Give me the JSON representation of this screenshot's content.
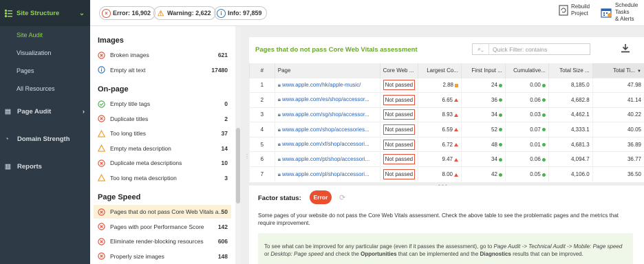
{
  "nav": {
    "header": "Site Structure",
    "sub_items": [
      "Site Audit",
      "Visualization",
      "Pages",
      "All Resources"
    ],
    "sections": [
      {
        "label": "Page Audit",
        "icon": "document-icon"
      },
      {
        "label": "Domain Strength",
        "icon": "gauge-icon"
      },
      {
        "label": "Reports",
        "icon": "report-icon"
      }
    ]
  },
  "topbar": {
    "error": "Error: 16,902",
    "warning": "Warning: 2,622",
    "info": "Info: 97,859",
    "rebuild": [
      "Rebuild",
      "Project"
    ],
    "schedule": [
      "Schedule",
      "Tasks",
      "& Alerts"
    ]
  },
  "issues": {
    "images_title": "Images",
    "images": [
      {
        "label": "Broken images",
        "count": "621",
        "type": "error"
      },
      {
        "label": "Empty alt text",
        "count": "17480",
        "type": "info"
      }
    ],
    "onpage_title": "On-page",
    "onpage": [
      {
        "label": "Empty title tags",
        "count": "0",
        "type": "ok"
      },
      {
        "label": "Duplicate titles",
        "count": "2",
        "type": "error"
      },
      {
        "label": "Too long titles",
        "count": "37",
        "type": "warning"
      },
      {
        "label": "Empty meta description",
        "count": "14",
        "type": "warning"
      },
      {
        "label": "Duplicate meta descriptions",
        "count": "10",
        "type": "error"
      },
      {
        "label": "Too long meta description",
        "count": "3",
        "type": "warning"
      }
    ],
    "speed_title": "Page Speed",
    "speed": [
      {
        "label": "Pages that do not pass Core Web Vitals a...",
        "count": "50",
        "type": "error"
      },
      {
        "label": "Pages with poor Performance Score",
        "count": "142",
        "type": "error"
      },
      {
        "label": "Eliminate render-blocking resources",
        "count": "606",
        "type": "error"
      },
      {
        "label": "Properly size images",
        "count": "148",
        "type": "error"
      }
    ]
  },
  "table": {
    "title": "Pages that do not pass Core Web Vitals assessment",
    "filter_placeholder": "Quick Filter: contains",
    "columns": [
      "#",
      "Page",
      "Core Web ...",
      "Largest Co...",
      "First Input ...",
      "Cumulative...",
      "Total Size ...",
      "Total Ti..."
    ],
    "rows": [
      {
        "n": "1",
        "page": "www.apple.com/hk/apple-music/",
        "cwv": "Not passed",
        "lcp": "2.88",
        "lcp_m": "sq",
        "fid": "24",
        "fid_m": "dot",
        "cls": "0.00",
        "cls_m": "dot",
        "size": "8,185.0",
        "time": "47.98"
      },
      {
        "n": "2",
        "page": "www.apple.com/es/shop/accessor...",
        "cwv": "Not passed",
        "lcp": "6.65",
        "lcp_m": "tri",
        "fid": "36",
        "fid_m": "dot",
        "cls": "0.06",
        "cls_m": "dot",
        "size": "4,682.8",
        "time": "41.14"
      },
      {
        "n": "3",
        "page": "www.apple.com/sg/shop/accessor...",
        "cwv": "Not passed",
        "lcp": "8.93",
        "lcp_m": "tri",
        "fid": "34",
        "fid_m": "dot",
        "cls": "0.03",
        "cls_m": "dot",
        "size": "4,462.1",
        "time": "40.22"
      },
      {
        "n": "4",
        "page": "www.apple.com/shop/accessories...",
        "cwv": "Not passed",
        "lcp": "6.59",
        "lcp_m": "tri",
        "fid": "52",
        "fid_m": "dot",
        "cls": "0.07",
        "cls_m": "dot",
        "size": "4,333.1",
        "time": "40.05"
      },
      {
        "n": "5",
        "page": "www.apple.com/xf/shop/accessori...",
        "cwv": "Not passed",
        "lcp": "6.72",
        "lcp_m": "tri",
        "fid": "48",
        "fid_m": "dot",
        "cls": "0.01",
        "cls_m": "dot",
        "size": "4,681.3",
        "time": "36.89"
      },
      {
        "n": "6",
        "page": "www.apple.com/pt/shop/accessori...",
        "cwv": "Not passed",
        "lcp": "9.47",
        "lcp_m": "tri",
        "fid": "34",
        "fid_m": "dot",
        "cls": "0.06",
        "cls_m": "dot",
        "size": "4,094.7",
        "time": "36.77"
      },
      {
        "n": "7",
        "page": "www.apple.com/pl/shop/accessori...",
        "cwv": "Not passed",
        "lcp": "8.00",
        "lcp_m": "tri",
        "fid": "42",
        "fid_m": "dot",
        "cls": "0.05",
        "cls_m": "dot",
        "size": "4,106.0",
        "time": "36.50"
      }
    ]
  },
  "factor": {
    "label": "Factor status:",
    "status": "Error",
    "description": "Some pages of your website do not pass the Core Web Vitals assessment. Check the above table to see the problematic pages and the metrics that require improvement.",
    "tip_parts": [
      {
        "t": "To see what can be improved for any particular page (even if it passes the assessment), go to ",
        "s": "n"
      },
      {
        "t": "Page Audit -> Technical Audit -> Mobile: Page speed",
        "s": "i"
      },
      {
        "t": " or ",
        "s": "n"
      },
      {
        "t": "Desktop: Page speed",
        "s": "i"
      },
      {
        "t": " and check the ",
        "s": "n"
      },
      {
        "t": "Opportunities",
        "s": "b"
      },
      {
        "t": " that can be implemented and the ",
        "s": "n"
      },
      {
        "t": "Diagnostics",
        "s": "b"
      },
      {
        "t": " results that can be improved.",
        "s": "n"
      }
    ]
  },
  "colors": {
    "accent": "#8fd44a",
    "error": "#e5533d",
    "warning": "#f0a030",
    "ok": "#4caf50",
    "info": "#2a7ac7"
  }
}
